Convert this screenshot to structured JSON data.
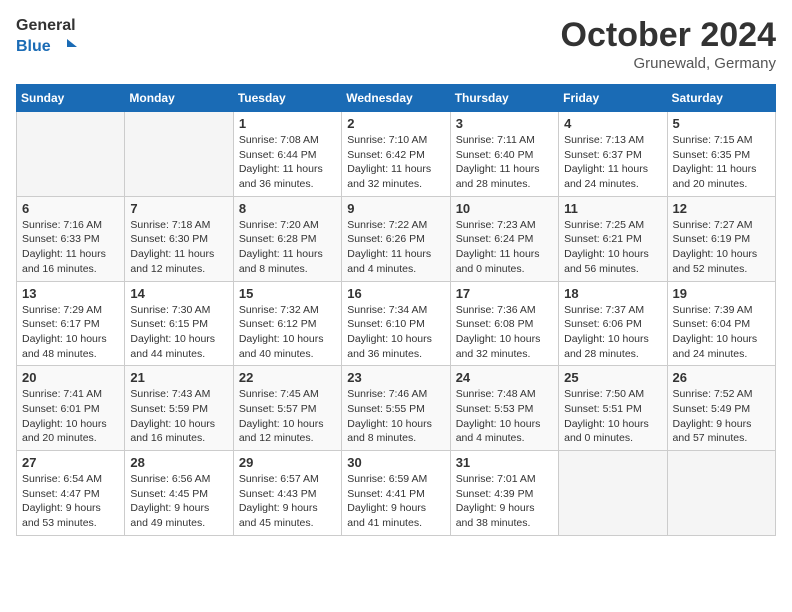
{
  "header": {
    "logo_line1": "General",
    "logo_line2": "Blue",
    "month": "October 2024",
    "location": "Grunewald, Germany"
  },
  "days_of_week": [
    "Sunday",
    "Monday",
    "Tuesday",
    "Wednesday",
    "Thursday",
    "Friday",
    "Saturday"
  ],
  "weeks": [
    [
      {
        "day": "",
        "info": ""
      },
      {
        "day": "",
        "info": ""
      },
      {
        "day": "1",
        "info": "Sunrise: 7:08 AM\nSunset: 6:44 PM\nDaylight: 11 hours\nand 36 minutes."
      },
      {
        "day": "2",
        "info": "Sunrise: 7:10 AM\nSunset: 6:42 PM\nDaylight: 11 hours\nand 32 minutes."
      },
      {
        "day": "3",
        "info": "Sunrise: 7:11 AM\nSunset: 6:40 PM\nDaylight: 11 hours\nand 28 minutes."
      },
      {
        "day": "4",
        "info": "Sunrise: 7:13 AM\nSunset: 6:37 PM\nDaylight: 11 hours\nand 24 minutes."
      },
      {
        "day": "5",
        "info": "Sunrise: 7:15 AM\nSunset: 6:35 PM\nDaylight: 11 hours\nand 20 minutes."
      }
    ],
    [
      {
        "day": "6",
        "info": "Sunrise: 7:16 AM\nSunset: 6:33 PM\nDaylight: 11 hours\nand 16 minutes."
      },
      {
        "day": "7",
        "info": "Sunrise: 7:18 AM\nSunset: 6:30 PM\nDaylight: 11 hours\nand 12 minutes."
      },
      {
        "day": "8",
        "info": "Sunrise: 7:20 AM\nSunset: 6:28 PM\nDaylight: 11 hours\nand 8 minutes."
      },
      {
        "day": "9",
        "info": "Sunrise: 7:22 AM\nSunset: 6:26 PM\nDaylight: 11 hours\nand 4 minutes."
      },
      {
        "day": "10",
        "info": "Sunrise: 7:23 AM\nSunset: 6:24 PM\nDaylight: 11 hours\nand 0 minutes."
      },
      {
        "day": "11",
        "info": "Sunrise: 7:25 AM\nSunset: 6:21 PM\nDaylight: 10 hours\nand 56 minutes."
      },
      {
        "day": "12",
        "info": "Sunrise: 7:27 AM\nSunset: 6:19 PM\nDaylight: 10 hours\nand 52 minutes."
      }
    ],
    [
      {
        "day": "13",
        "info": "Sunrise: 7:29 AM\nSunset: 6:17 PM\nDaylight: 10 hours\nand 48 minutes."
      },
      {
        "day": "14",
        "info": "Sunrise: 7:30 AM\nSunset: 6:15 PM\nDaylight: 10 hours\nand 44 minutes."
      },
      {
        "day": "15",
        "info": "Sunrise: 7:32 AM\nSunset: 6:12 PM\nDaylight: 10 hours\nand 40 minutes."
      },
      {
        "day": "16",
        "info": "Sunrise: 7:34 AM\nSunset: 6:10 PM\nDaylight: 10 hours\nand 36 minutes."
      },
      {
        "day": "17",
        "info": "Sunrise: 7:36 AM\nSunset: 6:08 PM\nDaylight: 10 hours\nand 32 minutes."
      },
      {
        "day": "18",
        "info": "Sunrise: 7:37 AM\nSunset: 6:06 PM\nDaylight: 10 hours\nand 28 minutes."
      },
      {
        "day": "19",
        "info": "Sunrise: 7:39 AM\nSunset: 6:04 PM\nDaylight: 10 hours\nand 24 minutes."
      }
    ],
    [
      {
        "day": "20",
        "info": "Sunrise: 7:41 AM\nSunset: 6:01 PM\nDaylight: 10 hours\nand 20 minutes."
      },
      {
        "day": "21",
        "info": "Sunrise: 7:43 AM\nSunset: 5:59 PM\nDaylight: 10 hours\nand 16 minutes."
      },
      {
        "day": "22",
        "info": "Sunrise: 7:45 AM\nSunset: 5:57 PM\nDaylight: 10 hours\nand 12 minutes."
      },
      {
        "day": "23",
        "info": "Sunrise: 7:46 AM\nSunset: 5:55 PM\nDaylight: 10 hours\nand 8 minutes."
      },
      {
        "day": "24",
        "info": "Sunrise: 7:48 AM\nSunset: 5:53 PM\nDaylight: 10 hours\nand 4 minutes."
      },
      {
        "day": "25",
        "info": "Sunrise: 7:50 AM\nSunset: 5:51 PM\nDaylight: 10 hours\nand 0 minutes."
      },
      {
        "day": "26",
        "info": "Sunrise: 7:52 AM\nSunset: 5:49 PM\nDaylight: 9 hours\nand 57 minutes."
      }
    ],
    [
      {
        "day": "27",
        "info": "Sunrise: 6:54 AM\nSunset: 4:47 PM\nDaylight: 9 hours\nand 53 minutes."
      },
      {
        "day": "28",
        "info": "Sunrise: 6:56 AM\nSunset: 4:45 PM\nDaylight: 9 hours\nand 49 minutes."
      },
      {
        "day": "29",
        "info": "Sunrise: 6:57 AM\nSunset: 4:43 PM\nDaylight: 9 hours\nand 45 minutes."
      },
      {
        "day": "30",
        "info": "Sunrise: 6:59 AM\nSunset: 4:41 PM\nDaylight: 9 hours\nand 41 minutes."
      },
      {
        "day": "31",
        "info": "Sunrise: 7:01 AM\nSunset: 4:39 PM\nDaylight: 9 hours\nand 38 minutes."
      },
      {
        "day": "",
        "info": ""
      },
      {
        "day": "",
        "info": ""
      }
    ]
  ]
}
